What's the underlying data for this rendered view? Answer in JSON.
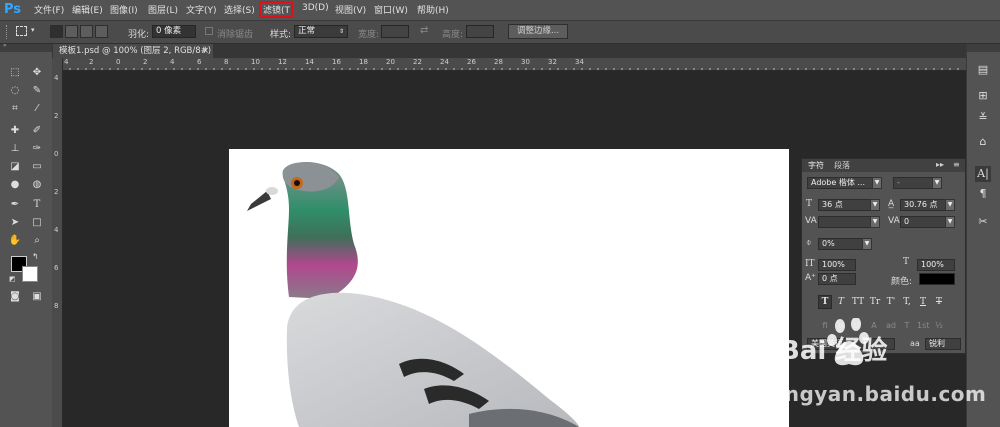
{
  "menu": {
    "logo": "Ps",
    "items": [
      "文件(F)",
      "编辑(E)",
      "图像(I)",
      "图层(L)",
      "文字(Y)",
      "选择(S)",
      "滤镜(T",
      "3D(D)",
      "视图(V)",
      "窗口(W)",
      "帮助(H)"
    ],
    "highlighted_item": "滤镜(T"
  },
  "options": {
    "feather_label": "羽化:",
    "feather_value": "0 像素",
    "antialias_label": "消除锯齿",
    "style_label": "样式:",
    "style_value": "正常",
    "width_label": "宽度:",
    "height_label": "高度:",
    "refine_edge": "调整边缘..."
  },
  "document": {
    "tab_title": "模板1.psd @ 100% (图层 2, RGB/8#)",
    "close": "×"
  },
  "rulers": {
    "top": [
      "4",
      "2",
      "0",
      "2",
      "4",
      "6",
      "8",
      "10",
      "12",
      "14",
      "16",
      "18",
      "20",
      "22",
      "24",
      "26",
      "28",
      "30",
      "32",
      "34"
    ],
    "left": [
      "4",
      "2",
      "0",
      "2",
      "4",
      "6",
      "8"
    ]
  },
  "character_panel": {
    "tabs": [
      "字符",
      "段落"
    ],
    "font_family": "Adobe 楷体 ...",
    "font_style": "-",
    "font_size": "36 点",
    "leading": "30.76 点",
    "kerning": "",
    "tracking": "0",
    "tsume": "0%",
    "vertical_scale": "100%",
    "horizontal_scale": "100%",
    "baseline_shift": "0 点",
    "color_label": "颜色:",
    "style_buttons": [
      "T",
      "T",
      "TT",
      "Tr",
      "T'",
      "T,",
      "T",
      "T"
    ],
    "opentype_buttons": [
      "fi",
      "σ",
      "st",
      "A",
      "ad",
      "T",
      "1st",
      "½"
    ],
    "language": "美国英语",
    "aa_label": "aa",
    "aa_value": "锐利"
  },
  "watermark": {
    "brand": "Bai 经验",
    "url": "jingyan.baidu.com"
  },
  "colors": {
    "menubar": "#535353",
    "workspace": "#282828",
    "highlight": "#e0101a",
    "ps_blue": "#31a8ff"
  }
}
